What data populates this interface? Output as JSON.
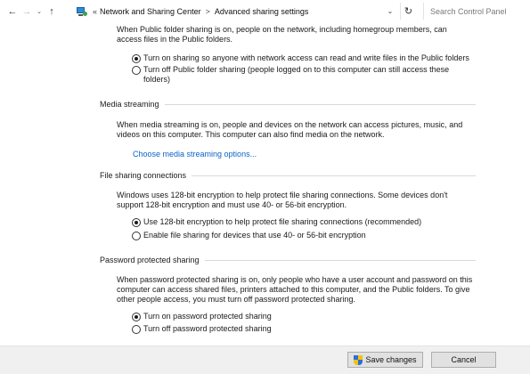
{
  "address_bar": {
    "breadcrumb_prefix": "«",
    "crumbs": [
      "Network and Sharing Center",
      "Advanced sharing settings"
    ],
    "separator": ">",
    "search_placeholder": "Search Control Panel"
  },
  "public_folder": {
    "description": "When Public folder sharing is on, people on the network, including homegroup members, can access files in the Public folders.",
    "options": [
      {
        "label": "Turn on sharing so anyone with network access can read and write files in the Public folders",
        "selected": true
      },
      {
        "label": "Turn off Public folder sharing (people logged on to this computer can still access these folders)",
        "selected": false
      }
    ]
  },
  "media_streaming": {
    "title": "Media streaming",
    "description": "When media streaming is on, people and devices on the network can access pictures, music, and videos on this computer. This computer can also find media on the network.",
    "link": "Choose media streaming options..."
  },
  "file_sharing": {
    "title": "File sharing connections",
    "description": "Windows uses 128-bit encryption to help protect file sharing connections. Some devices don't support 128-bit encryption and must use 40- or 56-bit encryption.",
    "options": [
      {
        "label": "Use 128-bit encryption to help protect file sharing connections (recommended)",
        "selected": true
      },
      {
        "label": "Enable file sharing for devices that use 40- or 56-bit encryption",
        "selected": false
      }
    ]
  },
  "password_sharing": {
    "title": "Password protected sharing",
    "description": "When password protected sharing is on, only people who have a user account and password on this computer can access shared files, printers attached to this computer, and the Public folders. To give other people access, you must turn off password protected sharing.",
    "options": [
      {
        "label": "Turn on password protected sharing",
        "selected": true
      },
      {
        "label": "Turn off password protected sharing",
        "selected": false
      }
    ]
  },
  "footer": {
    "save_label": "Save changes",
    "cancel_label": "Cancel"
  }
}
